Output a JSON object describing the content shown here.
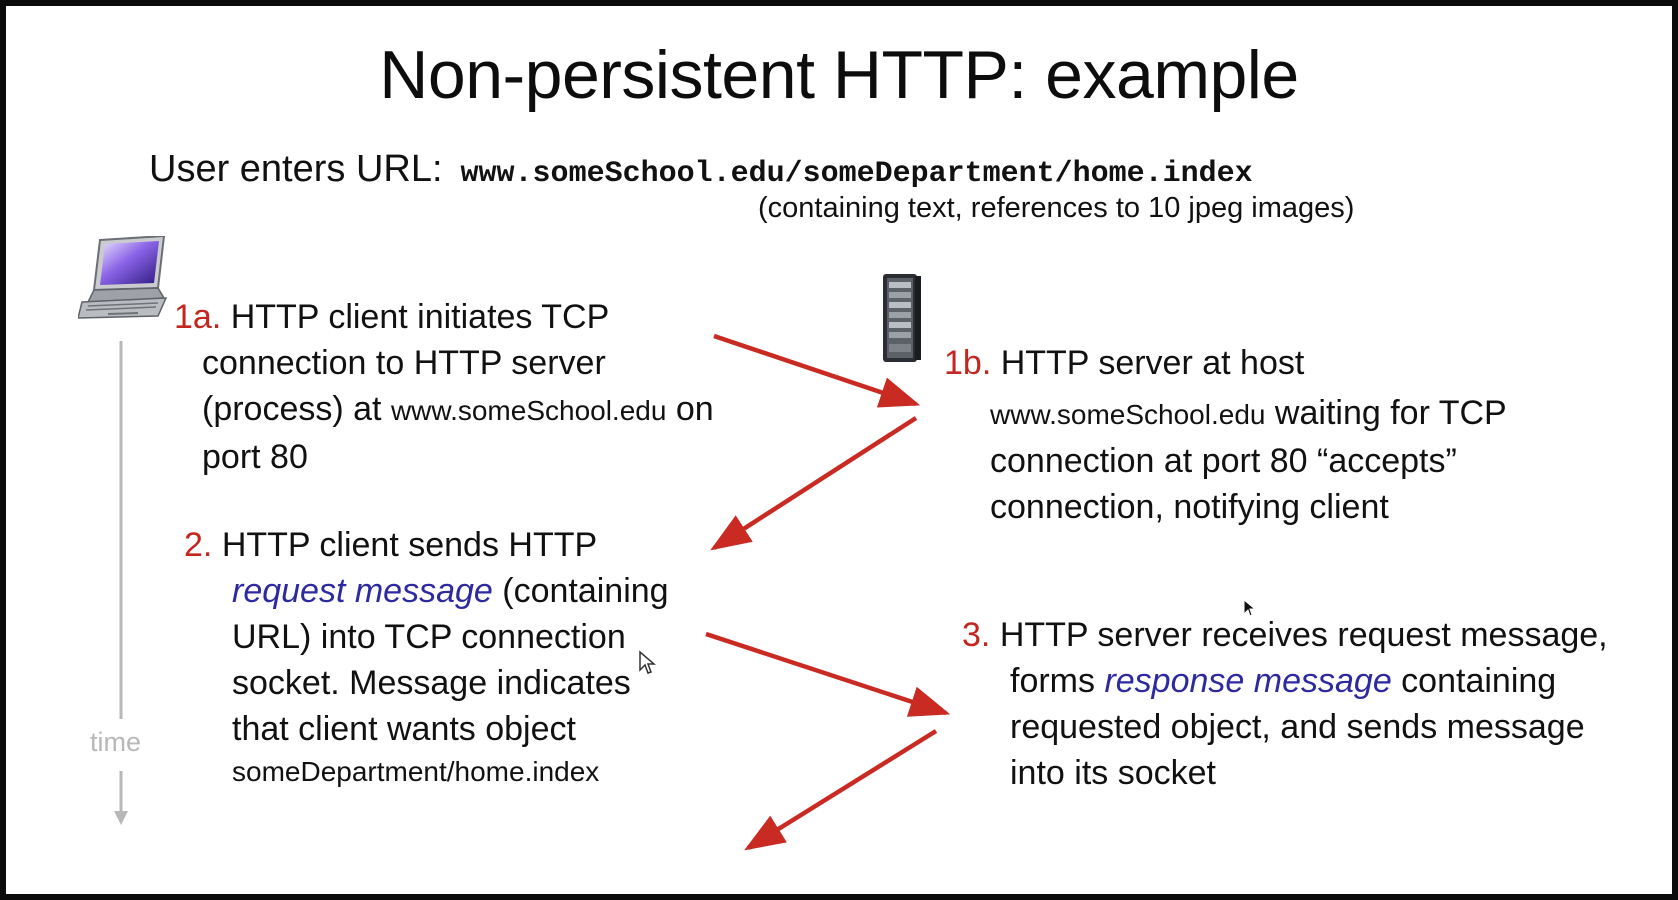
{
  "title": "Non-persistent HTTP: example",
  "url_prompt": {
    "label": "User enters URL:",
    "url": "www.someSchool.edu/someDepartment/home.index",
    "note": "(containing text, references to 10 jpeg images)"
  },
  "time_label": "time",
  "steps": {
    "s1a": {
      "num": "1a.",
      "l1": "HTTP client initiates TCP",
      "l2": "connection to HTTP server",
      "l3a": "(process) at ",
      "l3host": "www.someSchool.edu",
      "l3b": " on",
      "l4": "port 80"
    },
    "s1b": {
      "num": "1b.",
      "l1": "HTTP server at host",
      "l2host": "www.someSchool.edu",
      "l2b": " waiting for TCP",
      "l3": "connection at port 80  “accepts”",
      "l4": "connection, notifying client"
    },
    "s2": {
      "num": "2.",
      "l1": "HTTP client sends HTTP",
      "l2em": "request message",
      "l2b": " (containing",
      "l3": "URL) into TCP connection",
      "l4": "socket. Message indicates",
      "l5": "that client wants object",
      "l6": "someDepartment/home.index"
    },
    "s3": {
      "num": "3.",
      "l1": "HTTP server receives request message,",
      "l2a": "forms ",
      "l2em": "response message",
      "l2b": " containing",
      "l3": "requested object, and sends message",
      "l4": "into its socket"
    }
  },
  "icons": {
    "client": "laptop-computer-icon",
    "server": "server-tower-icon"
  },
  "colors": {
    "step_number": "#c2261e",
    "arrow": "#c92a22",
    "emphasis": "#2d2aa0",
    "timeline": "#b8b8b8"
  }
}
